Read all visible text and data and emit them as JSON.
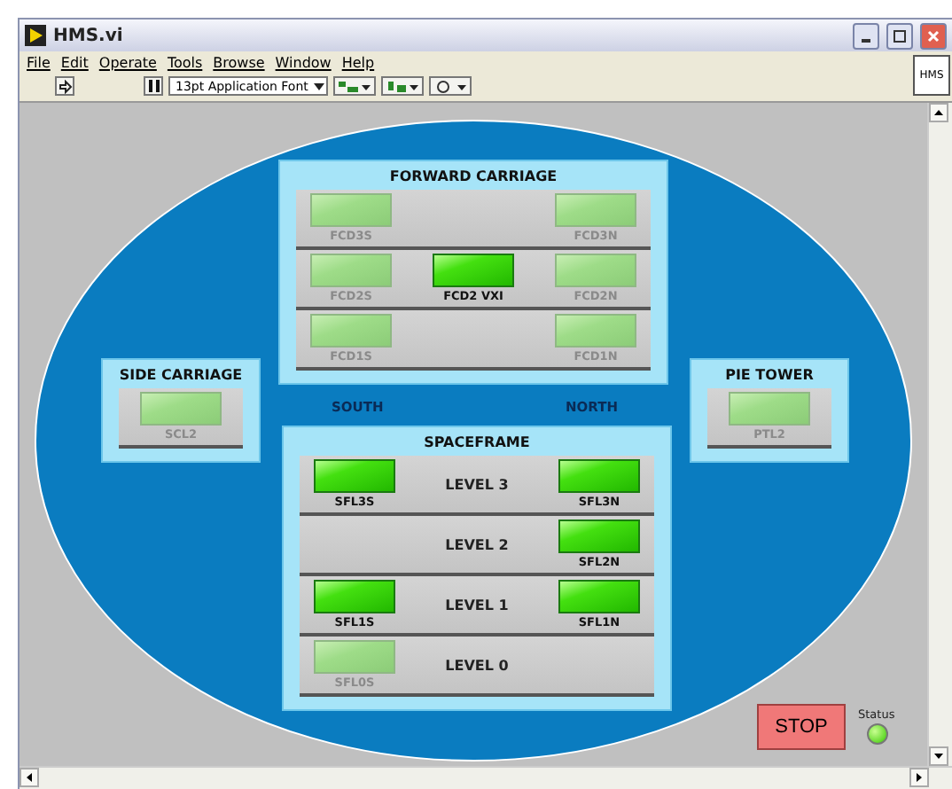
{
  "window": {
    "title": "HMS.vi",
    "icon_label": "HMS"
  },
  "menu": [
    "File",
    "Edit",
    "Operate",
    "Tools",
    "Browse",
    "Window",
    "Help"
  ],
  "toolbar": {
    "font": "13pt Application Font"
  },
  "panels": [
    {
      "title": "FORWARD CARRIAGE",
      "rows": [
        {
          "south": {
            "label": "FCD3S",
            "on": false
          },
          "north": {
            "label": "FCD3N",
            "on": false
          }
        },
        {
          "south": {
            "label": "FCD2S",
            "on": false
          },
          "center": {
            "label": "FCD2 VXI",
            "on": true
          },
          "north": {
            "label": "FCD2N",
            "on": false
          }
        },
        {
          "south": {
            "label": "FCD1S",
            "on": false
          },
          "north": {
            "label": "FCD1N",
            "on": false
          }
        }
      ]
    },
    {
      "title": "SIDE CARRIAGE",
      "rows": [
        {
          "center": {
            "label": "SCL2",
            "on": false
          }
        }
      ]
    },
    {
      "title": "PIE TOWER",
      "rows": [
        {
          "center": {
            "label": "PTL2",
            "on": false
          }
        }
      ]
    },
    {
      "title": "SPACEFRAME",
      "rows": [
        {
          "label": "LEVEL 3",
          "south": {
            "label": "SFL3S",
            "on": true
          },
          "north": {
            "label": "SFL3N",
            "on": true
          }
        },
        {
          "label": "LEVEL 2",
          "north": {
            "label": "SFL2N",
            "on": true
          }
        },
        {
          "label": "LEVEL 1",
          "south": {
            "label": "SFL1S",
            "on": true
          },
          "north": {
            "label": "SFL1N",
            "on": true
          }
        },
        {
          "label": "LEVEL 0",
          "south": {
            "label": "SFL0S",
            "on": false
          }
        }
      ]
    }
  ],
  "directions": [
    "SOUTH",
    "NORTH"
  ],
  "stop_button": "STOP",
  "status": {
    "label": "Status",
    "on": true
  }
}
